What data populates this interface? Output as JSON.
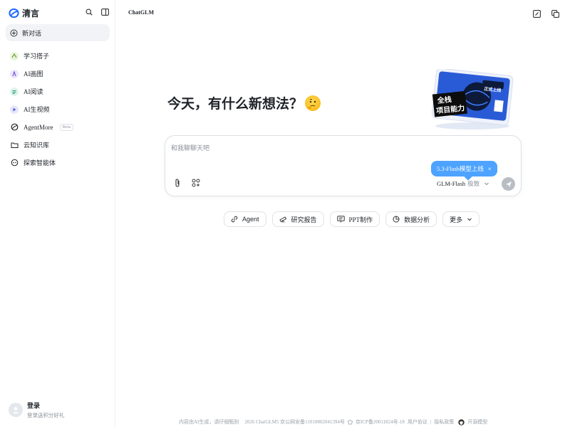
{
  "sidebar": {
    "logo_text": "清言",
    "new_chat_label": "新对话",
    "items": [
      {
        "label": "学习搭子",
        "icon": "study-icon",
        "color": "#e8f5d8"
      },
      {
        "label": "AI画图",
        "icon": "paint-icon",
        "color": "#ece6fb"
      },
      {
        "label": "AI阅读",
        "icon": "reading-icon",
        "color": "#dff4ec"
      },
      {
        "label": "AI生视频",
        "icon": "video-icon",
        "color": "#e6e8fb"
      },
      {
        "label": "AgentMore",
        "icon": "agent-icon",
        "badge": "Beta"
      },
      {
        "label": "云知识库",
        "icon": "folder-icon"
      },
      {
        "label": "探索智能体",
        "icon": "explore-icon"
      }
    ],
    "login": {
      "title": "登录",
      "subtitle": "登录送积分好礼"
    }
  },
  "header": {
    "brand": "ChatGLM"
  },
  "hero": {
    "title": "今天，有什么新想法？"
  },
  "promo": {
    "line1": "全栈",
    "line2": "项目能力",
    "badge": "正式上线"
  },
  "composer": {
    "placeholder": "和我聊聊天吧",
    "toast": "5.3-Flash模型上线",
    "toast_close": "×",
    "model_name": "GLM-Flash",
    "model_mode": "极致"
  },
  "chips": [
    {
      "label": "Agent",
      "icon": "link-icon"
    },
    {
      "label": "研究报告",
      "icon": "telescope-icon"
    },
    {
      "label": "PPT制作",
      "icon": "presentation-icon"
    },
    {
      "label": "数据分析",
      "icon": "pie-chart-icon"
    },
    {
      "label": "更多",
      "icon": "chevron-down-icon"
    }
  ],
  "footer": {
    "disclaimer": "内容由AI生成，请仔细甄别",
    "copyright": "2026 ChatGLM5 京公网安备11010802041394号",
    "icp": "京ICP备20011824号-18",
    "user_agreement": "用户协议",
    "separator": "|",
    "privacy": "隐私政策",
    "open_source": "开源模型"
  },
  "colors": {
    "accent": "#4da3ff",
    "send_disabled": "#b9bdc4",
    "logo_blue": "#1e6bff"
  }
}
